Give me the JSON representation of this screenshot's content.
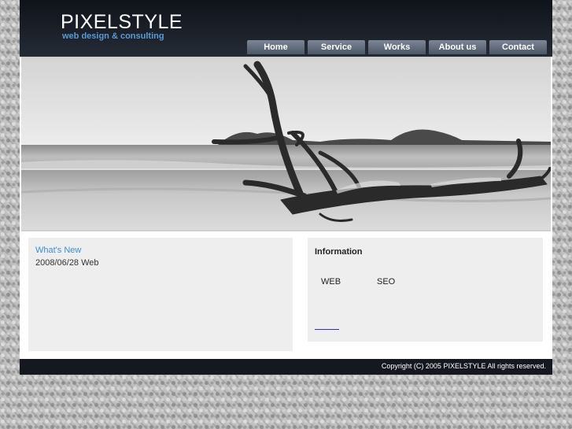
{
  "header": {
    "logo_title": "PIXELSTYLE",
    "logo_subtitle": "web design & consulting"
  },
  "nav": {
    "items": [
      "Home",
      "Service",
      "Works",
      "About us",
      "Contact"
    ]
  },
  "whats_new": {
    "title": "What's New",
    "entry": "2008/06/28 Web"
  },
  "information": {
    "title": "Information",
    "col1": "WEB",
    "col2": "SEO"
  },
  "footer": {
    "copyright": "Copyright (C) 2005 PIXELSTYLE All rights reserved."
  },
  "colors": {
    "header_bg": "#1a1f27",
    "accent_blue": "#3a8fd6",
    "panel_bg": "#eeeeee",
    "nav_tab": "#6a7383"
  },
  "hero": {
    "icon": "beach-driftwood-photo"
  }
}
